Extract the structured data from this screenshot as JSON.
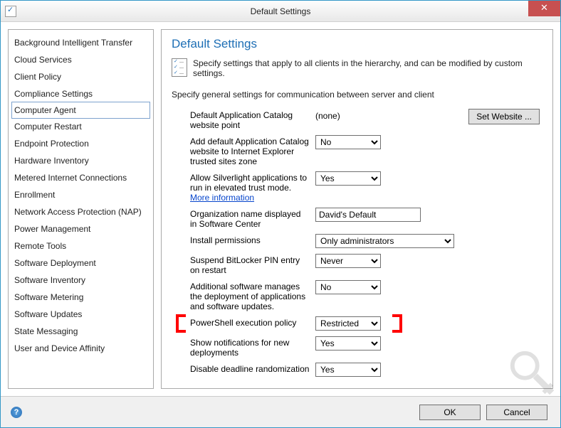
{
  "title": "Default Settings",
  "close_glyph": "✕",
  "sidebar": {
    "items": [
      {
        "label": "Background Intelligent Transfer"
      },
      {
        "label": "Cloud Services"
      },
      {
        "label": "Client Policy"
      },
      {
        "label": "Compliance Settings"
      },
      {
        "label": "Computer Agent",
        "selected": true
      },
      {
        "label": "Computer Restart"
      },
      {
        "label": "Endpoint Protection"
      },
      {
        "label": "Hardware Inventory"
      },
      {
        "label": "Metered Internet Connections"
      },
      {
        "label": "Enrollment"
      },
      {
        "label": "Network Access Protection (NAP)"
      },
      {
        "label": "Power Management"
      },
      {
        "label": "Remote Tools"
      },
      {
        "label": "Software Deployment"
      },
      {
        "label": "Software Inventory"
      },
      {
        "label": "Software Metering"
      },
      {
        "label": "Software Updates"
      },
      {
        "label": "State Messaging"
      },
      {
        "label": "User and Device Affinity"
      }
    ]
  },
  "header": "Default Settings",
  "intro": "Specify settings that apply to all clients in the hierarchy, and can be modified by custom settings.",
  "subintro": "Specify general settings for communication between server and client",
  "rows": {
    "r0": {
      "label": "Default Application Catalog website point",
      "value": "(none)",
      "button": "Set Website ..."
    },
    "r1": {
      "label": "Add default Application Catalog website to Internet Explorer trusted sites zone",
      "value": "No"
    },
    "r2": {
      "label_a": "Allow Silverlight applications to run in elevated trust mode. ",
      "label_b": "More information",
      "value": "Yes"
    },
    "r3": {
      "label": "Organization name displayed in Software Center",
      "value": "David's Default"
    },
    "r4": {
      "label": "Install permissions",
      "value": "Only administrators"
    },
    "r5": {
      "label": "Suspend BitLocker PIN entry on restart",
      "value": "Never"
    },
    "r6": {
      "label": "Additional software manages the deployment of applications and software updates.",
      "value": "No"
    },
    "r7": {
      "label": "PowerShell execution policy",
      "value": "Restricted"
    },
    "r8": {
      "label": "Show notifications for new deployments",
      "value": "Yes"
    },
    "r9": {
      "label": "Disable deadline randomization",
      "value": "Yes"
    }
  },
  "footer": {
    "ok": "OK",
    "cancel": "Cancel",
    "help": "?"
  }
}
